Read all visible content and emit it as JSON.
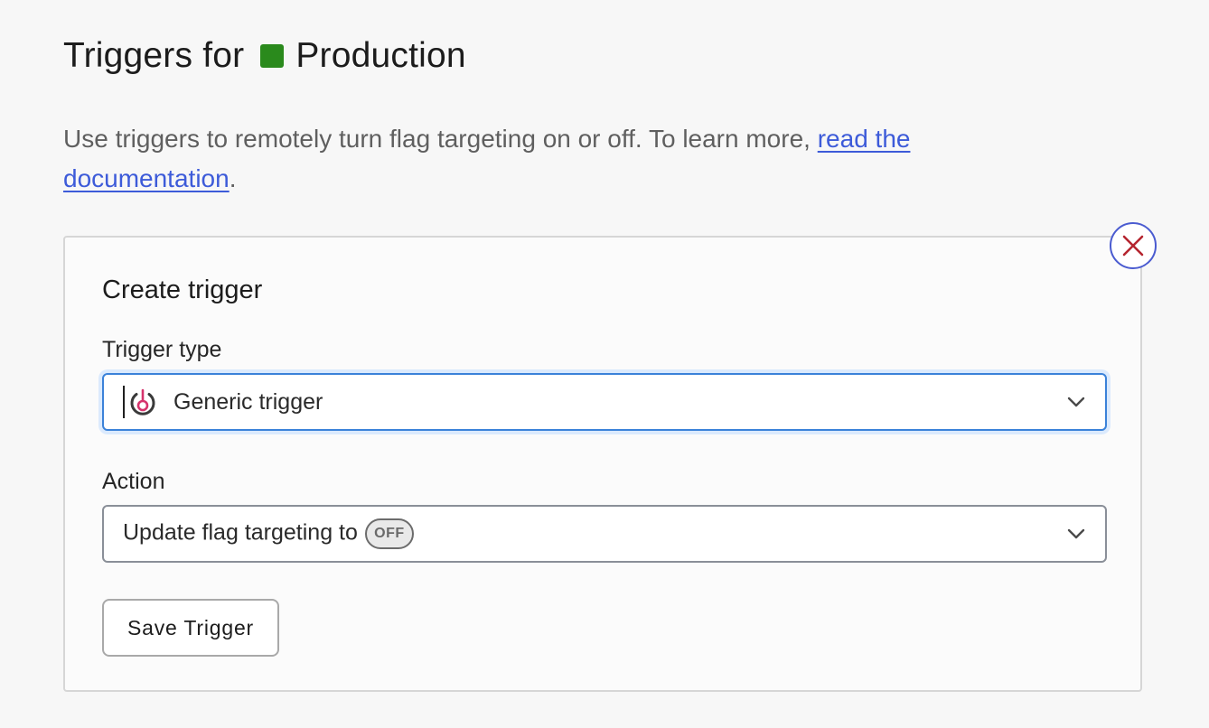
{
  "header": {
    "title_prefix": "Triggers for",
    "environment_name": "Production",
    "environment_color": "#2a8a1c"
  },
  "intro": {
    "text": "Use triggers to remotely turn flag targeting on or off. To learn more, ",
    "link_text": "read the documentation",
    "suffix": "."
  },
  "create_trigger": {
    "title": "Create trigger",
    "trigger_type": {
      "label": "Trigger type",
      "selected": "Generic trigger",
      "icon": "generic-trigger-icon"
    },
    "action": {
      "label": "Action",
      "selected_prefix": "Update flag targeting to",
      "badge": "OFF"
    },
    "save_label": "Save Trigger",
    "close_icon": "close-icon"
  },
  "colors": {
    "link": "#3d5bd9",
    "focus_border": "#3b82d9",
    "close_x": "#b5252f",
    "close_ring": "#4a5bd0",
    "trigger_icon_accent": "#d6336c"
  }
}
